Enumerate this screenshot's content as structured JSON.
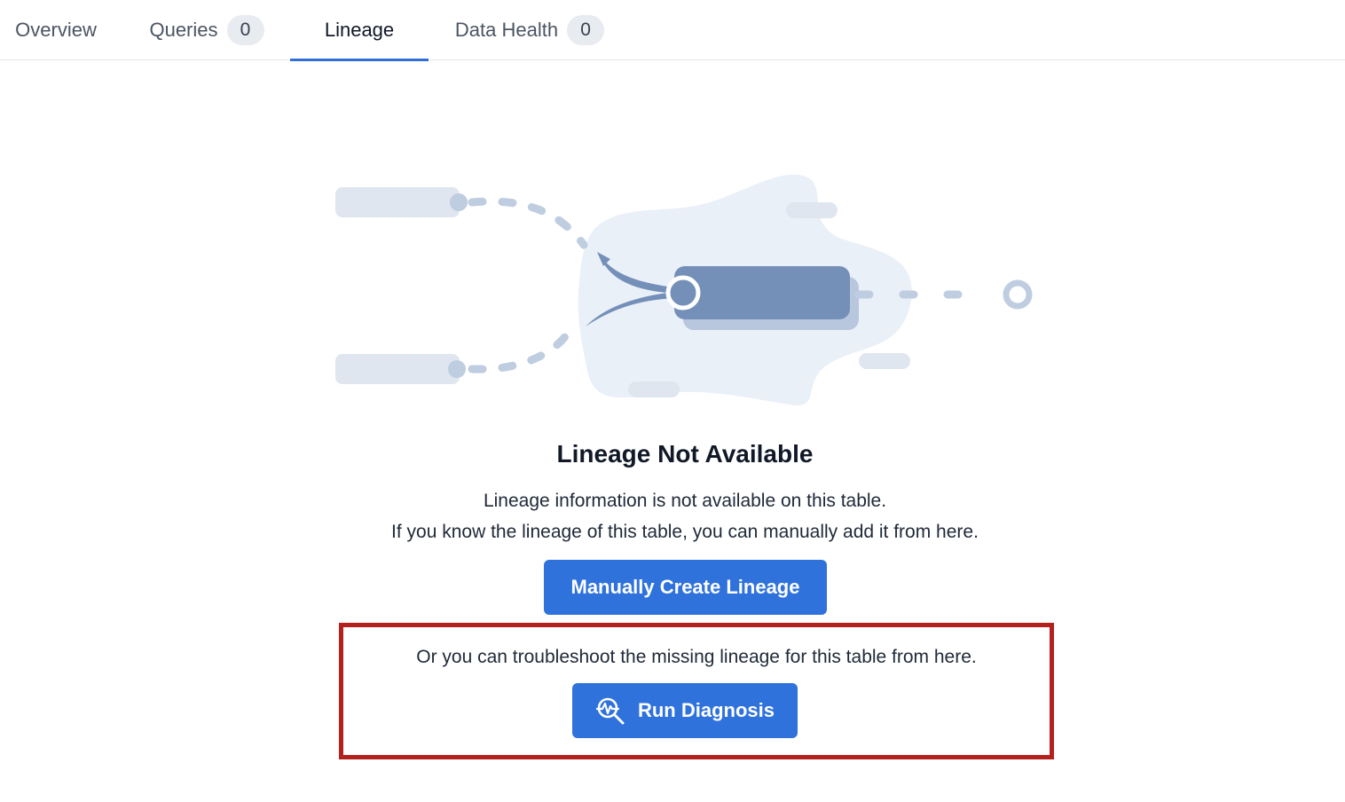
{
  "tabs": [
    {
      "label": "Overview",
      "count": null,
      "active": false
    },
    {
      "label": "Queries",
      "count": "0",
      "active": false
    },
    {
      "label": "Lineage",
      "count": null,
      "active": true
    },
    {
      "label": "Data Health",
      "count": "0",
      "active": false
    }
  ],
  "empty_state": {
    "title": "Lineage Not Available",
    "line1": "Lineage information is not available on this table.",
    "line2": "If you know the lineage of this table, you can manually add it from here.",
    "manual_button": "Manually Create Lineage",
    "troubleshoot_text": "Or you can troubleshoot the missing lineage for this table from here.",
    "diagnosis_button": "Run Diagnosis",
    "diagnosis_icon": "search-pulse-icon"
  },
  "colors": {
    "accent": "#2f72db",
    "highlight_border": "#b3201e",
    "illustration_primary": "#7490b8",
    "illustration_light": "#dfe6ef"
  }
}
